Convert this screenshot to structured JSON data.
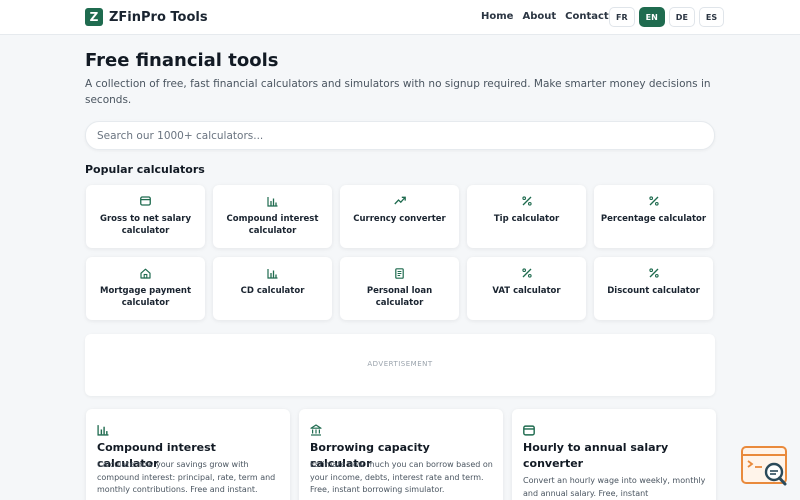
{
  "header": {
    "logo_letter": "Z",
    "brand": "ZFinPro Tools",
    "nav": [
      "Home",
      "About",
      "Contact"
    ],
    "languages": [
      "FR",
      "EN",
      "DE",
      "ES"
    ],
    "active_language": "EN"
  },
  "hero": {
    "title": "Free financial tools",
    "subtitle": "A collection of free, fast financial calculators and simulators with no signup required. Make smarter money decisions in seconds."
  },
  "search": {
    "placeholder": "Search our 1000+ calculators..."
  },
  "popular": {
    "title": "Popular calculators",
    "items": [
      {
        "label": "Gross to net salary calculator",
        "icon": "wallet-icon"
      },
      {
        "label": "Compound interest calculator",
        "icon": "bar-chart-icon"
      },
      {
        "label": "Currency converter",
        "icon": "trending-up-icon"
      },
      {
        "label": "Tip calculator",
        "icon": "percent-icon"
      },
      {
        "label": "Percentage calculator",
        "icon": "percent-icon"
      },
      {
        "label": "Mortgage payment calculator",
        "icon": "home-icon"
      },
      {
        "label": "CD calculator",
        "icon": "bar-chart-icon"
      },
      {
        "label": "Personal loan calculator",
        "icon": "document-icon"
      },
      {
        "label": "VAT calculator",
        "icon": "percent-icon"
      },
      {
        "label": "Discount calculator",
        "icon": "percent-icon"
      }
    ]
  },
  "ad": {
    "label": "ADVERTISEMENT"
  },
  "features": [
    {
      "title": "Compound interest calculator",
      "desc": "Calculate how your savings grow with compound interest: principal, rate, term and monthly contributions. Free and instant.",
      "icon": "bar-chart-icon"
    },
    {
      "title": "Borrowing capacity calculator",
      "desc": "Estimate how much you can borrow based on your income, debts, interest rate and term. Free, instant borrowing simulator.",
      "icon": "bank-icon"
    },
    {
      "title": "Hourly to annual salary converter",
      "desc": "Convert an hourly wage into weekly, monthly and annual salary. Free, instant",
      "icon": "wallet-icon"
    }
  ],
  "colors": {
    "accent": "#1f6b4f",
    "background": "#f5f7f9",
    "widget": "#e98a3c"
  }
}
